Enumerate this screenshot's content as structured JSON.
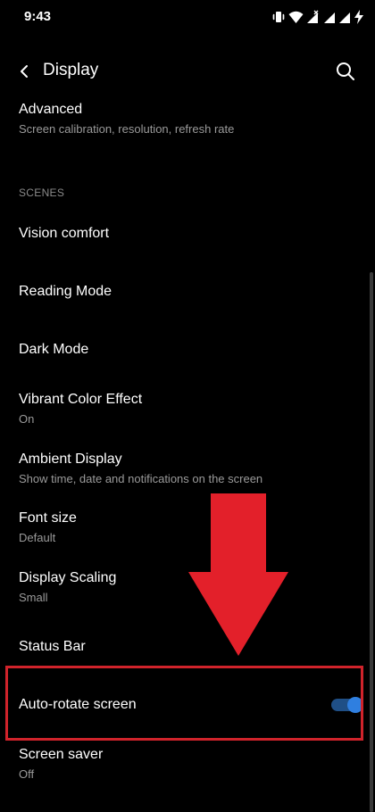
{
  "status_bar": {
    "time": "9:43",
    "icons": [
      "vibrate-icon",
      "wifi-icon",
      "signal-x-icon",
      "signal-icon",
      "signal-icon",
      "battery-charging-icon"
    ]
  },
  "app_bar": {
    "title": "Display",
    "back_icon": "back-arrow-icon",
    "search_icon": "search-icon"
  },
  "items": {
    "advanced": {
      "title": "Advanced",
      "subtitle": "Screen calibration, resolution, refresh rate"
    },
    "scenes_header": "SCENES",
    "vision_comfort": {
      "title": "Vision comfort"
    },
    "reading_mode": {
      "title": "Reading Mode"
    },
    "dark_mode": {
      "title": "Dark Mode"
    },
    "vibrant_color": {
      "title": "Vibrant Color Effect",
      "subtitle": "On"
    },
    "ambient_display": {
      "title": "Ambient Display",
      "subtitle": "Show time, date and notifications on the screen"
    },
    "font_size": {
      "title": "Font size",
      "subtitle": "Default"
    },
    "display_scaling": {
      "title": "Display Scaling",
      "subtitle": "Small"
    },
    "status_bar": {
      "title": "Status Bar"
    },
    "auto_rotate": {
      "title": "Auto-rotate screen",
      "enabled": true
    },
    "screen_saver": {
      "title": "Screen saver",
      "subtitle": "Off"
    }
  },
  "colors": {
    "background": "#000000",
    "accent": "#2f7fe0",
    "annotation": "#e3202a",
    "subtitle": "#9a9a9a"
  }
}
